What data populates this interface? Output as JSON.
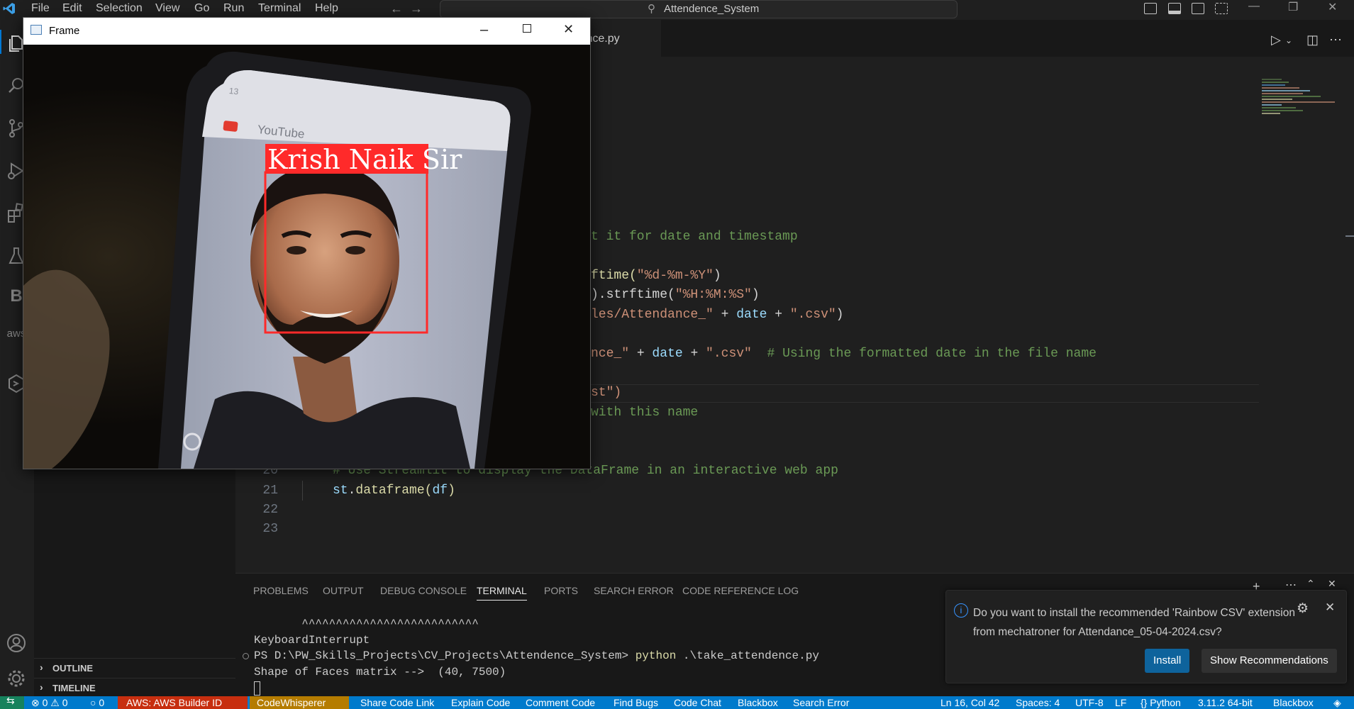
{
  "menu": [
    "File",
    "Edit",
    "Selection",
    "View",
    "Go",
    "Run",
    "Terminal",
    "Help"
  ],
  "command_center": "Attendence_System",
  "editor": {
    "tab_label": "ttendence.py",
    "lines": {
      "l12": "t it for date and timestamp",
      "l14a": "ftime(",
      "l14b": "\"%d-%m-%Y\"",
      "l14c": ")",
      "l15a": ").strftime(",
      "l15b": "\"%H:%M:%S\"",
      "l15c": ")",
      "l16a": "les/Attendance_\"",
      "l16b": " + ",
      "l16c": "date",
      "l16d": " + ",
      "l16e": "\".csv\"",
      "l16f": ")",
      "l18a": "nce_\"",
      "l18b": " + ",
      "l18c": "date",
      "l18d": " + ",
      "l18e": "\".csv\"",
      "l18f": "  # Using the formatted date in the file name",
      "l20": "st\")",
      "l21": "with this name",
      "l23": "# Use Streamlit to display the DataFrame in an interactive web app",
      "l24a": "st",
      "l24b": ".",
      "l24c": "dataframe",
      "l24d": "(",
      "l24e": "df",
      "l24f": ")"
    },
    "line_numbers": [
      "20",
      "21",
      "22",
      "23"
    ]
  },
  "sidebar": {
    "outline": "OUTLINE",
    "timeline": "TIMELINE"
  },
  "panel": {
    "tabs": [
      "PROBLEMS",
      "OUTPUT",
      "DEBUG CONSOLE",
      "TERMINAL",
      "PORTS",
      "SEARCH ERROR",
      "CODE REFERENCE LOG"
    ],
    "active_tab": "TERMINAL",
    "terminal": {
      "carets": "       ^^^^^^^^^^^^^^^^^^^^^^^^^^",
      "line1": "KeyboardInterrupt",
      "prompt": "PS D:\\PW_Skills_Projects\\CV_Projects\\Attendence_System> ",
      "cmd": "python",
      "cmd_arg": " .\\take_attendence.py",
      "line3": "Shape of Faces matrix -->  (40, 7500)"
    }
  },
  "notification": {
    "message": "Do you want to install the recommended 'Rainbow CSV' extension from mechatroner for Attendance_05-04-2024.csv?",
    "install": "Install",
    "show": "Show Recommendations"
  },
  "statusbar": {
    "problems": "⊗ 0 ⚠ 0",
    "ports": "○ 0",
    "aws": "AWS: AWS Builder ID",
    "codewhisperer": "CodeWhisperer",
    "share": "Share Code Link",
    "explain": "Explain Code",
    "comment": "Comment Code",
    "bugs": "Find Bugs",
    "chat": "Code Chat",
    "blackbox": "Blackbox",
    "search_error": "Search Error",
    "position": "Ln 16, Col 42",
    "spaces": "Spaces: 4",
    "encoding": "UTF-8",
    "eol": "LF",
    "language": "Python",
    "interpreter": "3.11.2 64-bit",
    "blackbox2": "Blackbox"
  },
  "frame_window": {
    "title": "Frame",
    "label": "Krish Naik Sir",
    "phone_app": "YouTube",
    "phone_status": "13"
  },
  "colors": {
    "accent": "#007acc",
    "label_bg": "#ff2a2a",
    "aws_bg": "#c72e0f",
    "codewhisperer_bg": "#b57c00",
    "button_bg": "#0e639c"
  }
}
